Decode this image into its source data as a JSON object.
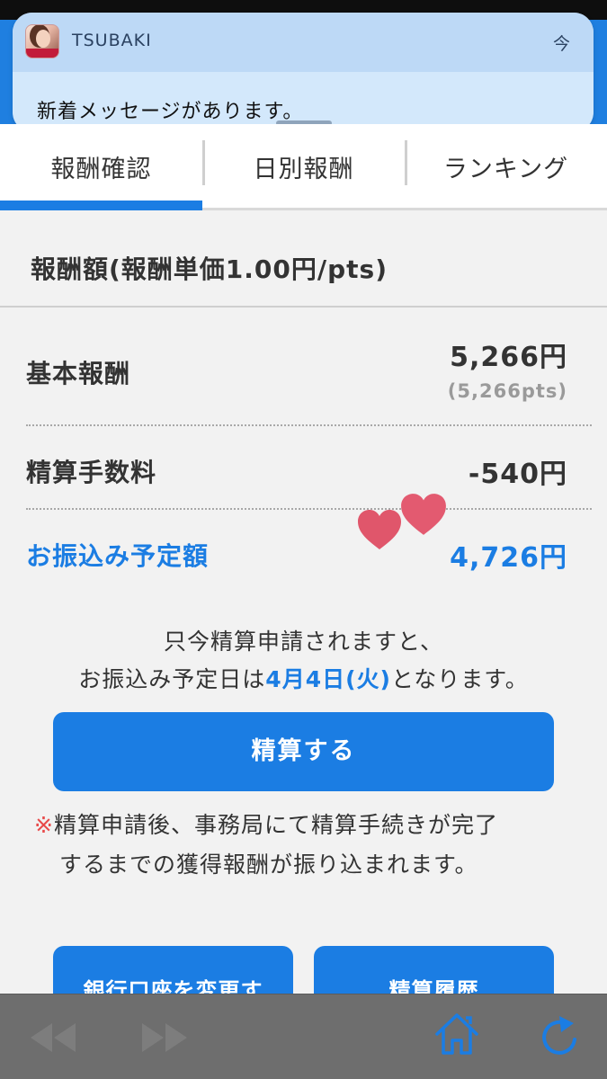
{
  "notification": {
    "app_name": "TSUBAKI",
    "time": "今",
    "message": "新着メッセージがあります。"
  },
  "tabs": [
    {
      "label": "報酬確認",
      "active": true
    },
    {
      "label": "日別報酬",
      "active": false
    },
    {
      "label": "ランキング",
      "active": false
    }
  ],
  "section_title": "報酬額(報酬単価1.00円/pts)",
  "rows": {
    "base": {
      "label": "基本報酬",
      "value": "5,266円",
      "sub": "(5,266pts)"
    },
    "fee": {
      "label": "精算手数料",
      "value": "-540円"
    },
    "transfer": {
      "label": "お振込み予定額",
      "value": "4,726円"
    }
  },
  "notice": {
    "line1": "只今精算申請されますと、",
    "line2_prefix": "お振込み予定日は",
    "line2_date": "4月4日(火)",
    "line2_suffix": "となります。"
  },
  "settle_button": "精算する",
  "warning": {
    "mark": "※",
    "line1": "精算申請後、事務局にて精算手続きが完了",
    "line2": "するまでの獲得報酬が振り込まれます。"
  },
  "bottom_buttons": {
    "change_bank": "銀行口座を変更す",
    "history": "精算履歴"
  },
  "toolbar": {
    "back": "rewind-icon",
    "forward": "fast-forward-icon",
    "home": "home-icon",
    "reload": "reload-icon"
  },
  "colors": {
    "accent": "#1b7de3",
    "warning_mark": "#e84a4a",
    "heart": "#e0566b"
  }
}
